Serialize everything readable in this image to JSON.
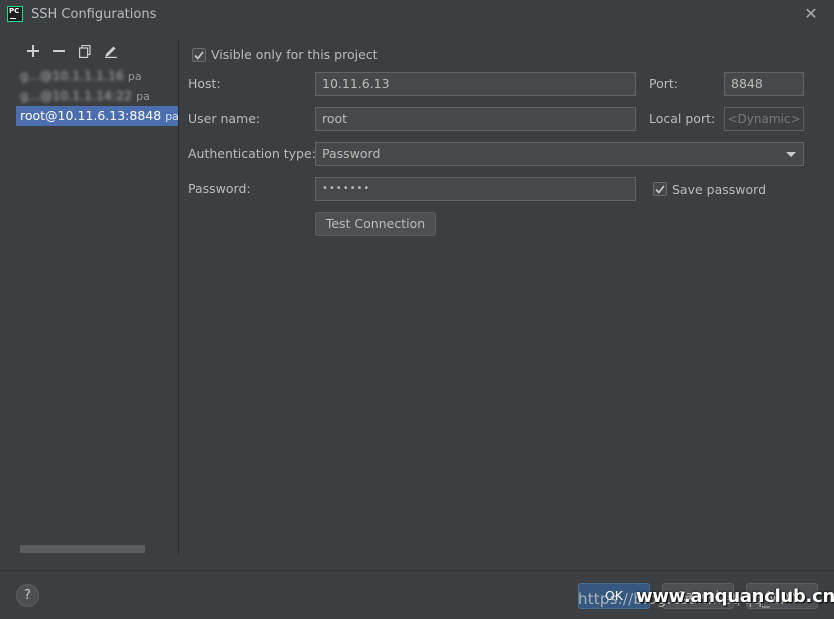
{
  "window": {
    "title": "SSH Configurations",
    "app_badge": "PC"
  },
  "toolbar": {
    "add_icon": "plus-icon",
    "remove_icon": "minus-icon",
    "copy_icon": "copy-icon",
    "edit_icon": "pencil-icon"
  },
  "connections": [
    {
      "label": "g...@10.1.1.1.16",
      "suffix": "pa",
      "blurred": true
    },
    {
      "label": "g...@10.1.1.14:22",
      "suffix": "pa",
      "blurred": true
    },
    {
      "label": "root@10.11.6.13:8848",
      "suffix": "passw",
      "selected": true
    }
  ],
  "form": {
    "visible_only_label": "Visible only for this project",
    "host_label": "Host:",
    "host_value": "10.11.6.13",
    "port_label": "Port:",
    "port_value": "8848",
    "user_label": "User name:",
    "user_value": "root",
    "local_port_label": "Local port:",
    "local_port_placeholder": "<Dynamic>",
    "auth_label": "Authentication type:",
    "auth_value": "Password",
    "password_label": "Password:",
    "password_value": "•••••••",
    "save_password_label": "Save password",
    "test_connection_label": "Test Connection"
  },
  "footer": {
    "help_label": "?",
    "ok_label": "OK",
    "cancel_label": "Cancel",
    "apply_label": "Apply"
  },
  "watermark": {
    "url": "https://blog.csdn.net/qq_...",
    "brand": "www.anquanclub.cn"
  },
  "colors": {
    "background": "#3c3f41",
    "selection": "#4b6eaf",
    "primary_button": "#365880",
    "field": "#45494a"
  }
}
